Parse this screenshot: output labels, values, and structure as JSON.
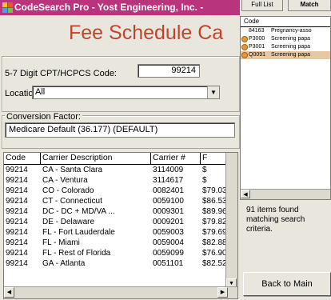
{
  "window": {
    "title": "CodeSearch Pro - Yost Engineering, Inc. -"
  },
  "heading": "Fee Schedule Ca",
  "code_input": {
    "label": "5-7 Digit CPT/HCPCS Code:",
    "value": "99214"
  },
  "location": {
    "label": "Location:",
    "value": "All"
  },
  "conversion": {
    "label": "Conversion Factor:",
    "value": "Medicare Default (36.177)  (DEFAULT)"
  },
  "table": {
    "columns": [
      "Code",
      "Carrier Description",
      "Carrier #",
      "F"
    ],
    "rows": [
      [
        "99214",
        "CA - Santa Clara",
        "3114009",
        "$"
      ],
      [
        "99214",
        "CA - Ventura",
        "3114617",
        "$"
      ],
      [
        "99214",
        "CO - Colorado",
        "0082401",
        "$79.03"
      ],
      [
        "99214",
        "CT - Connecticut",
        "0059100",
        "$86.53"
      ],
      [
        "99214",
        "DC - DC + MD/VA ...",
        "0009301",
        "$89.96"
      ],
      [
        "99214",
        "DE - Delaware",
        "0009201",
        "$79.82"
      ],
      [
        "99214",
        "FL - Fort Lauderdale",
        "0059003",
        "$79.69"
      ],
      [
        "99214",
        "FL - Miami",
        "0059004",
        "$82.88"
      ],
      [
        "99214",
        "FL - Rest of Florida",
        "0059099",
        "$76.90"
      ],
      [
        "99214",
        "GA - Atlanta",
        "0051101",
        "$82.52"
      ]
    ]
  },
  "right_panel": {
    "tabs": [
      "Full List",
      "Match"
    ],
    "results_header": "Code",
    "results": [
      {
        "code": "84163",
        "desc": "Pregnancy-asso",
        "icon": "none"
      },
      {
        "code": "P3000",
        "desc": "Screening papa",
        "icon": "warning-icon"
      },
      {
        "code": "P3001",
        "desc": "Screening papa",
        "icon": "warning-icon"
      },
      {
        "code": "Q0091",
        "desc": "Screening papa",
        "icon": "warning-icon"
      }
    ],
    "items_found": "91 items found matching search criteria.",
    "back_button": "Back to Main"
  },
  "colors": {
    "title_bar": "#b8357e",
    "heading": "#c0452e"
  }
}
